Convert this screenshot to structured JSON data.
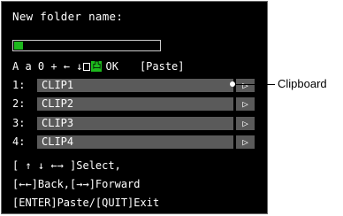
{
  "prompt": "New folder name:",
  "toolbar": {
    "chars": "A a 0 + ← ↓",
    "ok": "OK",
    "paste": "[Paste]",
    "highlight": "凸"
  },
  "clips": [
    {
      "index": "1:",
      "label": "CLIP1",
      "forward": "▷"
    },
    {
      "index": "2:",
      "label": "CLIP2",
      "forward": "▷"
    },
    {
      "index": "3:",
      "label": "CLIP3",
      "forward": "▷"
    },
    {
      "index": "4:",
      "label": "CLIP4",
      "forward": "▷"
    }
  ],
  "help": [
    "[ ↑ ↓ ←→ ]Select,",
    "[←←]Back,[→→]Forward",
    "[ENTER]Paste/[QUIT]Exit"
  ],
  "callout": "Clipboard"
}
